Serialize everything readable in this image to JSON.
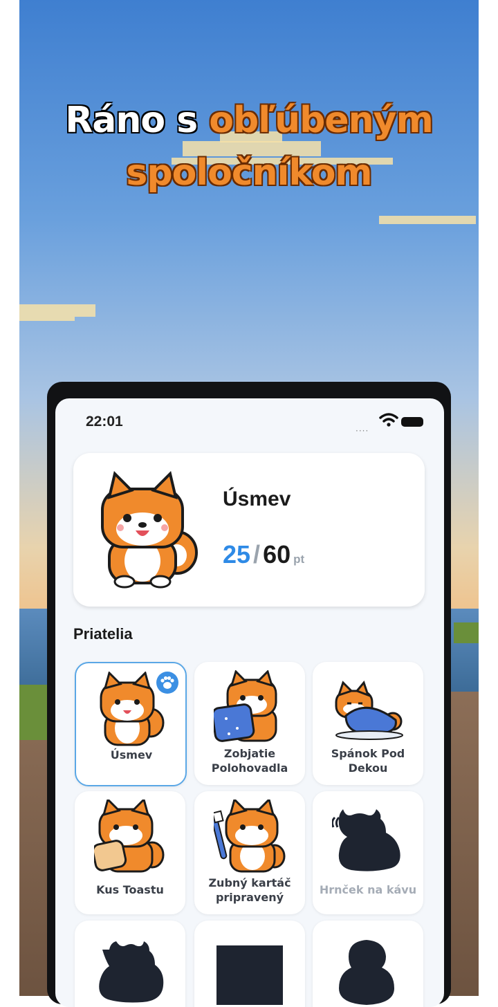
{
  "headline": {
    "part1": "Ráno s",
    "part2": "obľúbeným",
    "part3": "spoločníkom"
  },
  "status_bar": {
    "time": "22:01",
    "signal": "····"
  },
  "hero": {
    "name": "Úsmev",
    "current": "25",
    "separator": "/",
    "max": "60",
    "unit": "pt"
  },
  "section_title": "Priatelia",
  "friends": [
    {
      "label": "Úsmev",
      "state": "selected"
    },
    {
      "label": "Zobjatie Polohovadla",
      "state": "unlocked"
    },
    {
      "label": "Spánok Pod Dekou",
      "state": "unlocked"
    },
    {
      "label": "Kus Toastu",
      "state": "unlocked"
    },
    {
      "label": "Zubný kartáč pripravený",
      "state": "unlocked"
    },
    {
      "label": "Hrnček na kávu",
      "state": "locked"
    },
    {
      "label": "",
      "state": "locked"
    },
    {
      "label": "",
      "state": "locked"
    },
    {
      "label": "",
      "state": "locked"
    }
  ],
  "colors": {
    "accent": "#2e8ae6",
    "headline_orange": "#f08a2c",
    "card_border_selected": "#5aa7e6",
    "silhouette": "#1e2430"
  }
}
